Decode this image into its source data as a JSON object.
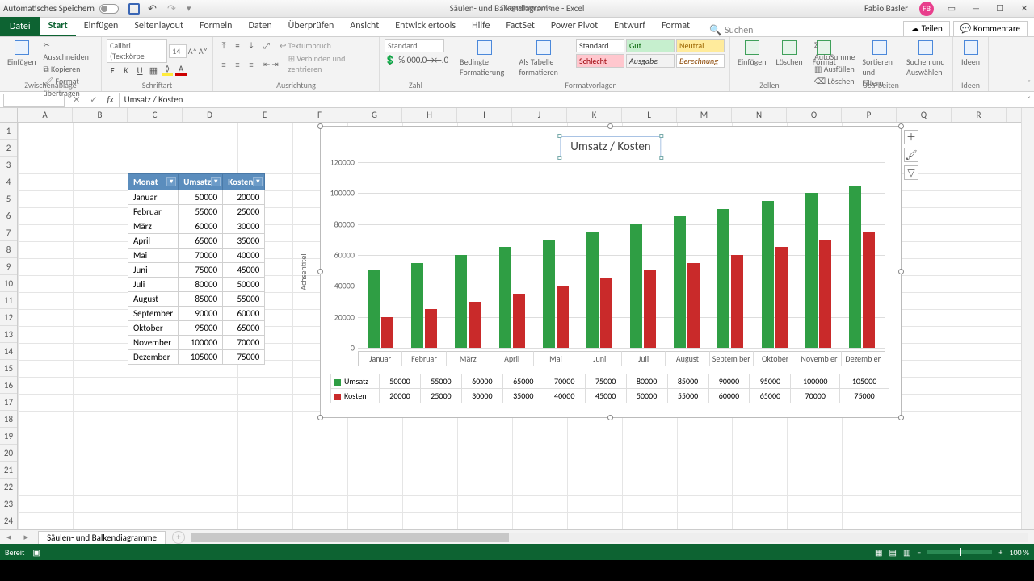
{
  "titlebar": {
    "autosave_label": "Automatisches Speichern",
    "doc_title": "Säulen- und Balkendiagramme - Excel",
    "tool_context": "Diagrammtools",
    "user": "Fabio Basler",
    "avatar_initials": "FB"
  },
  "ribbon": {
    "file": "Datei",
    "tabs": [
      "Start",
      "Einfügen",
      "Seitenlayout",
      "Formeln",
      "Daten",
      "Überprüfen",
      "Ansicht",
      "Entwicklertools",
      "Hilfe",
      "FactSet",
      "Power Pivot",
      "Entwurf",
      "Format"
    ],
    "active_tab": "Start",
    "search_placeholder": "Suchen",
    "share": "Teilen",
    "comments": "Kommentare",
    "clipboard": {
      "cut": "Ausschneiden",
      "copy": "Kopieren",
      "fmt": "Format übertragen",
      "paste": "Einfügen",
      "label": "Zwischenablage"
    },
    "font": {
      "name": "Calibri (Textkörpe",
      "size": "14",
      "label": "Schriftart"
    },
    "align": {
      "wrap": "Textumbruch",
      "merge": "Verbinden und zentrieren",
      "label": "Ausrichtung"
    },
    "number": {
      "format": "Standard",
      "label": "Zahl"
    },
    "styles": {
      "cond": "Bedingte Formatierung",
      "table": "Als Tabelle formatieren",
      "s1": "Standard",
      "s2": "Gut",
      "s3": "Neutral",
      "s4": "Schlecht",
      "s5": "Ausgabe",
      "s6": "Berechnung",
      "label": "Formatvorlagen"
    },
    "cells": {
      "insert": "Einfügen",
      "delete": "Löschen",
      "fmt": "Format",
      "label": "Zellen"
    },
    "editing": {
      "sum": "AutoSumme",
      "fill": "Ausfüllen",
      "clear": "Löschen",
      "sort": "Sortieren und Filtern",
      "find": "Suchen und Auswählen",
      "label": "Bearbeiten"
    },
    "ideas": {
      "btn": "Ideen",
      "label": "Ideen"
    }
  },
  "formula_bar": {
    "namebox": "",
    "fx": "fx",
    "value": "Umsatz / Kosten"
  },
  "columns": [
    "A",
    "B",
    "C",
    "D",
    "E",
    "F",
    "G",
    "H",
    "I",
    "J",
    "K",
    "L",
    "M",
    "N",
    "O",
    "P",
    "Q",
    "R"
  ],
  "rows": 24,
  "table": {
    "headers": [
      "Monat",
      "Umsatz",
      "Kosten"
    ],
    "rows": [
      [
        "Januar",
        "50000",
        "20000"
      ],
      [
        "Februar",
        "55000",
        "25000"
      ],
      [
        "März",
        "60000",
        "30000"
      ],
      [
        "April",
        "65000",
        "35000"
      ],
      [
        "Mai",
        "70000",
        "40000"
      ],
      [
        "Juni",
        "75000",
        "45000"
      ],
      [
        "Juli",
        "80000",
        "50000"
      ],
      [
        "August",
        "85000",
        "55000"
      ],
      [
        "September",
        "90000",
        "60000"
      ],
      [
        "Oktober",
        "95000",
        "65000"
      ],
      [
        "November",
        "100000",
        "70000"
      ],
      [
        "Dezember",
        "105000",
        "75000"
      ]
    ]
  },
  "chart_data": {
    "type": "bar",
    "title": "Umsatz / Kosten",
    "ylabel": "Achsentitel",
    "xlabel": "",
    "ylim": [
      0,
      120000
    ],
    "yticks": [
      0,
      20000,
      40000,
      60000,
      80000,
      100000,
      120000
    ],
    "categories": [
      "Januar",
      "Februar",
      "März",
      "April",
      "Mai",
      "Juni",
      "Juli",
      "August",
      "September",
      "Oktober",
      "November",
      "Dezember"
    ],
    "categories_wrapped": [
      "Januar",
      "Februar",
      "März",
      "April",
      "Mai",
      "Juni",
      "Juli",
      "August",
      "Septem ber",
      "Oktober",
      "Novemb er",
      "Dezemb er"
    ],
    "series": [
      {
        "name": "Umsatz",
        "color": "#2f9e44",
        "values": [
          50000,
          55000,
          60000,
          65000,
          70000,
          75000,
          80000,
          85000,
          90000,
          95000,
          100000,
          105000
        ]
      },
      {
        "name": "Kosten",
        "color": "#c92a2a",
        "values": [
          20000,
          25000,
          30000,
          35000,
          40000,
          45000,
          50000,
          55000,
          60000,
          65000,
          70000,
          75000
        ]
      }
    ]
  },
  "sheet_tabs": {
    "active": "Säulen- und Balkendiagramme"
  },
  "status": {
    "ready": "Bereit",
    "zoom": "100 %"
  }
}
